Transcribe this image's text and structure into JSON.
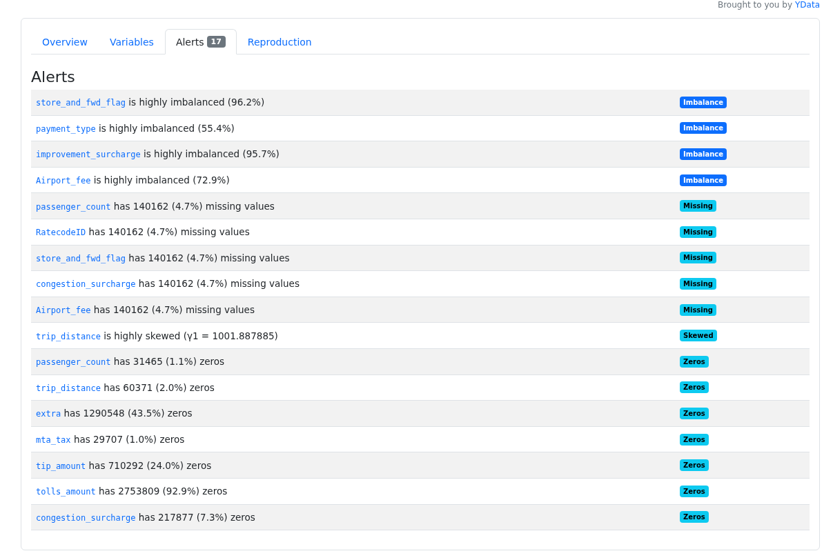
{
  "credit": {
    "text": "Brought to you by",
    "link": "YData"
  },
  "tabs": [
    {
      "label": "Overview",
      "selected": false
    },
    {
      "label": "Variables",
      "selected": false
    },
    {
      "label": "Alerts",
      "count": "17",
      "selected": true
    },
    {
      "label": "Reproduction",
      "selected": false
    }
  ],
  "heading": "Alerts",
  "alerts": [
    {
      "variable": "store_and_fwd_flag",
      "text": "is highly imbalanced (96.2%)",
      "badge": "Imbalance",
      "kind": "imbalance"
    },
    {
      "variable": "payment_type",
      "text": "is highly imbalanced (55.4%)",
      "badge": "Imbalance",
      "kind": "imbalance"
    },
    {
      "variable": "improvement_surcharge",
      "text": "is highly imbalanced (95.7%)",
      "badge": "Imbalance",
      "kind": "imbalance"
    },
    {
      "variable": "Airport_fee",
      "text": "is highly imbalanced (72.9%)",
      "badge": "Imbalance",
      "kind": "imbalance"
    },
    {
      "variable": "passenger_count",
      "text": "has 140162 (4.7%) missing values",
      "badge": "Missing",
      "kind": "missing"
    },
    {
      "variable": "RatecodeID",
      "text": "has 140162 (4.7%) missing values",
      "badge": "Missing",
      "kind": "missing"
    },
    {
      "variable": "store_and_fwd_flag",
      "text": "has 140162 (4.7%) missing values",
      "badge": "Missing",
      "kind": "missing"
    },
    {
      "variable": "congestion_surcharge",
      "text": "has 140162 (4.7%) missing values",
      "badge": "Missing",
      "kind": "missing"
    },
    {
      "variable": "Airport_fee",
      "text": "has 140162 (4.7%) missing values",
      "badge": "Missing",
      "kind": "missing"
    },
    {
      "variable": "trip_distance",
      "text": "is highly skewed (γ1 = 1001.887885)",
      "badge": "Skewed",
      "kind": "skewed"
    },
    {
      "variable": "passenger_count",
      "text": "has 31465 (1.1%) zeros",
      "badge": "Zeros",
      "kind": "zeros"
    },
    {
      "variable": "trip_distance",
      "text": "has 60371 (2.0%) zeros",
      "badge": "Zeros",
      "kind": "zeros"
    },
    {
      "variable": "extra",
      "text": "has 1290548 (43.5%) zeros",
      "badge": "Zeros",
      "kind": "zeros"
    },
    {
      "variable": "mta_tax",
      "text": "has 29707 (1.0%) zeros",
      "badge": "Zeros",
      "kind": "zeros"
    },
    {
      "variable": "tip_amount",
      "text": "has 710292 (24.0%) zeros",
      "badge": "Zeros",
      "kind": "zeros"
    },
    {
      "variable": "tolls_amount",
      "text": "has 2753809 (92.9%) zeros",
      "badge": "Zeros",
      "kind": "zeros"
    },
    {
      "variable": "congestion_surcharge",
      "text": "has 217877 (7.3%) zeros",
      "badge": "Zeros",
      "kind": "zeros"
    }
  ]
}
